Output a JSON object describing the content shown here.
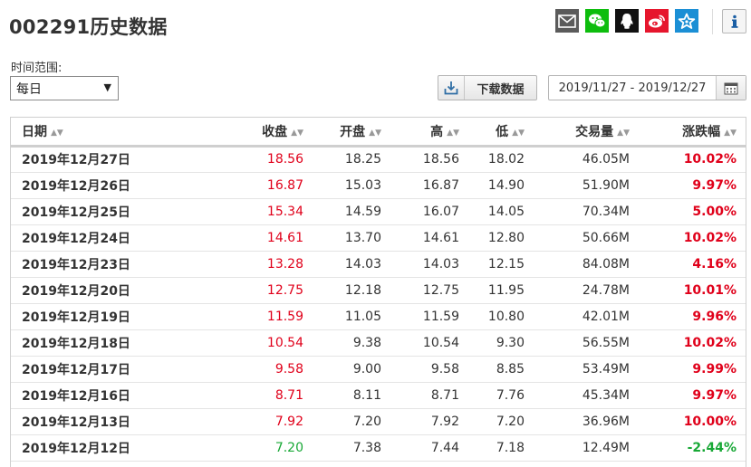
{
  "page": {
    "title": "002291历史数据"
  },
  "share": [
    {
      "name": "email-icon"
    },
    {
      "name": "wechat-icon"
    },
    {
      "name": "qq-icon"
    },
    {
      "name": "weibo-icon"
    },
    {
      "name": "star-icon"
    }
  ],
  "info_icon": "info-icon",
  "colors": {
    "up": "#e0001a",
    "down": "#18a836",
    "text": "#333333",
    "email": "#5b5b5b",
    "wechat": "#0dbd0d",
    "qq": "#111111",
    "weibo": "#e6162d",
    "star": "#1b8fd5"
  },
  "filters": {
    "range_label": "时间范围:",
    "frequency_value": "每日",
    "download_label": "下载数据",
    "date_range": "2019/11/27 - 2019/12/27"
  },
  "table": {
    "columns": [
      "日期",
      "收盘",
      "开盘",
      "高",
      "低",
      "交易量",
      "涨跌幅"
    ],
    "rows": [
      {
        "date": "2019年12月27日",
        "close": "18.56",
        "open": "18.25",
        "high": "18.56",
        "low": "18.02",
        "volume": "46.05M",
        "change": "10.02%",
        "dir": "up"
      },
      {
        "date": "2019年12月26日",
        "close": "16.87",
        "open": "15.03",
        "high": "16.87",
        "low": "14.90",
        "volume": "51.90M",
        "change": "9.97%",
        "dir": "up"
      },
      {
        "date": "2019年12月25日",
        "close": "15.34",
        "open": "14.59",
        "high": "16.07",
        "low": "14.05",
        "volume": "70.34M",
        "change": "5.00%",
        "dir": "up"
      },
      {
        "date": "2019年12月24日",
        "close": "14.61",
        "open": "13.70",
        "high": "14.61",
        "low": "12.80",
        "volume": "50.66M",
        "change": "10.02%",
        "dir": "up"
      },
      {
        "date": "2019年12月23日",
        "close": "13.28",
        "open": "14.03",
        "high": "14.03",
        "low": "12.15",
        "volume": "84.08M",
        "change": "4.16%",
        "dir": "up"
      },
      {
        "date": "2019年12月20日",
        "close": "12.75",
        "open": "12.18",
        "high": "12.75",
        "low": "11.95",
        "volume": "24.78M",
        "change": "10.01%",
        "dir": "up"
      },
      {
        "date": "2019年12月19日",
        "close": "11.59",
        "open": "11.05",
        "high": "11.59",
        "low": "10.80",
        "volume": "42.01M",
        "change": "9.96%",
        "dir": "up"
      },
      {
        "date": "2019年12月18日",
        "close": "10.54",
        "open": "9.38",
        "high": "10.54",
        "low": "9.30",
        "volume": "56.55M",
        "change": "10.02%",
        "dir": "up"
      },
      {
        "date": "2019年12月17日",
        "close": "9.58",
        "open": "9.00",
        "high": "9.58",
        "low": "8.85",
        "volume": "53.49M",
        "change": "9.99%",
        "dir": "up"
      },
      {
        "date": "2019年12月16日",
        "close": "8.71",
        "open": "8.11",
        "high": "8.71",
        "low": "7.76",
        "volume": "45.34M",
        "change": "9.97%",
        "dir": "up"
      },
      {
        "date": "2019年12月13日",
        "close": "7.92",
        "open": "7.20",
        "high": "7.92",
        "low": "7.20",
        "volume": "36.96M",
        "change": "10.00%",
        "dir": "up"
      },
      {
        "date": "2019年12月12日",
        "close": "7.20",
        "open": "7.38",
        "high": "7.44",
        "low": "7.18",
        "volume": "12.49M",
        "change": "-2.44%",
        "dir": "down"
      }
    ]
  }
}
